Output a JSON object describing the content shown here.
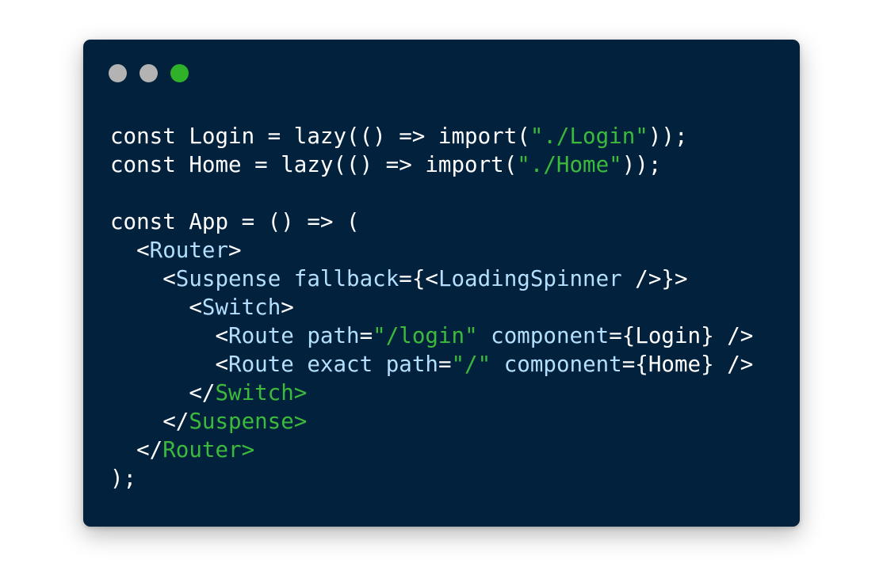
{
  "window": {
    "background": "#01213d",
    "controls": [
      {
        "name": "close-dot",
        "color": "#b3b3b3"
      },
      {
        "name": "minimize-dot",
        "color": "#b3b3b3"
      },
      {
        "name": "maximize-dot",
        "color": "#2fb12a"
      }
    ]
  },
  "colors": {
    "plain": "#ffffff",
    "keyword": "#b5dfff",
    "string": "#3cba3c"
  },
  "code": {
    "lines": [
      [
        {
          "t": "const Login = lazy(() => import(",
          "c": "plain"
        },
        {
          "t": "\"./Login\"",
          "c": "string"
        },
        {
          "t": "));",
          "c": "plain"
        }
      ],
      [
        {
          "t": "const Home = lazy(() => import(",
          "c": "plain"
        },
        {
          "t": "\"./Home\"",
          "c": "string"
        },
        {
          "t": "));",
          "c": "plain"
        }
      ],
      [],
      [
        {
          "t": "const App = () => (",
          "c": "plain"
        }
      ],
      [
        {
          "t": "  <",
          "c": "plain"
        },
        {
          "t": "Router",
          "c": "keyword"
        },
        {
          "t": ">",
          "c": "plain"
        }
      ],
      [
        {
          "t": "    <",
          "c": "plain"
        },
        {
          "t": "Suspense",
          "c": "keyword"
        },
        {
          "t": " fallback",
          "c": "keyword"
        },
        {
          "t": "={<",
          "c": "plain"
        },
        {
          "t": "LoadingSpinner",
          "c": "keyword"
        },
        {
          "t": " />}>",
          "c": "plain"
        }
      ],
      [
        {
          "t": "      <",
          "c": "plain"
        },
        {
          "t": "Switch",
          "c": "keyword"
        },
        {
          "t": ">",
          "c": "plain"
        }
      ],
      [
        {
          "t": "        <",
          "c": "plain"
        },
        {
          "t": "Route",
          "c": "keyword"
        },
        {
          "t": " path",
          "c": "keyword"
        },
        {
          "t": "=",
          "c": "plain"
        },
        {
          "t": "\"/login\"",
          "c": "string"
        },
        {
          "t": " component",
          "c": "keyword"
        },
        {
          "t": "={Login} />",
          "c": "plain"
        }
      ],
      [
        {
          "t": "        <",
          "c": "plain"
        },
        {
          "t": "Route",
          "c": "keyword"
        },
        {
          "t": " exact path",
          "c": "keyword"
        },
        {
          "t": "=",
          "c": "plain"
        },
        {
          "t": "\"/\"",
          "c": "string"
        },
        {
          "t": " component",
          "c": "keyword"
        },
        {
          "t": "={Home} />",
          "c": "plain"
        }
      ],
      [
        {
          "t": "      </",
          "c": "plain"
        },
        {
          "t": "Switch",
          "c": "string"
        },
        {
          "t": ">",
          "c": "string"
        }
      ],
      [
        {
          "t": "    </",
          "c": "plain"
        },
        {
          "t": "Suspense",
          "c": "string"
        },
        {
          "t": ">",
          "c": "string"
        }
      ],
      [
        {
          "t": "  </",
          "c": "plain"
        },
        {
          "t": "Router",
          "c": "string"
        },
        {
          "t": ">",
          "c": "string"
        }
      ],
      [
        {
          "t": ");",
          "c": "plain"
        }
      ]
    ]
  }
}
